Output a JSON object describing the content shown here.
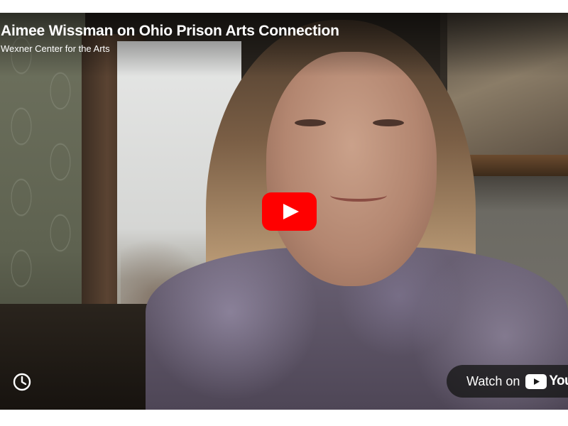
{
  "video": {
    "title": "Aimee Wissman on Ohio Prison Arts Connection",
    "channel": "Wexner Center for the Arts"
  },
  "controls": {
    "play_icon": "youtube-play-icon",
    "watch_later_icon": "clock-icon",
    "watch_on_label": "Watch on",
    "youtube_wordmark": "YouTube",
    "play_color": "#ff0000"
  }
}
